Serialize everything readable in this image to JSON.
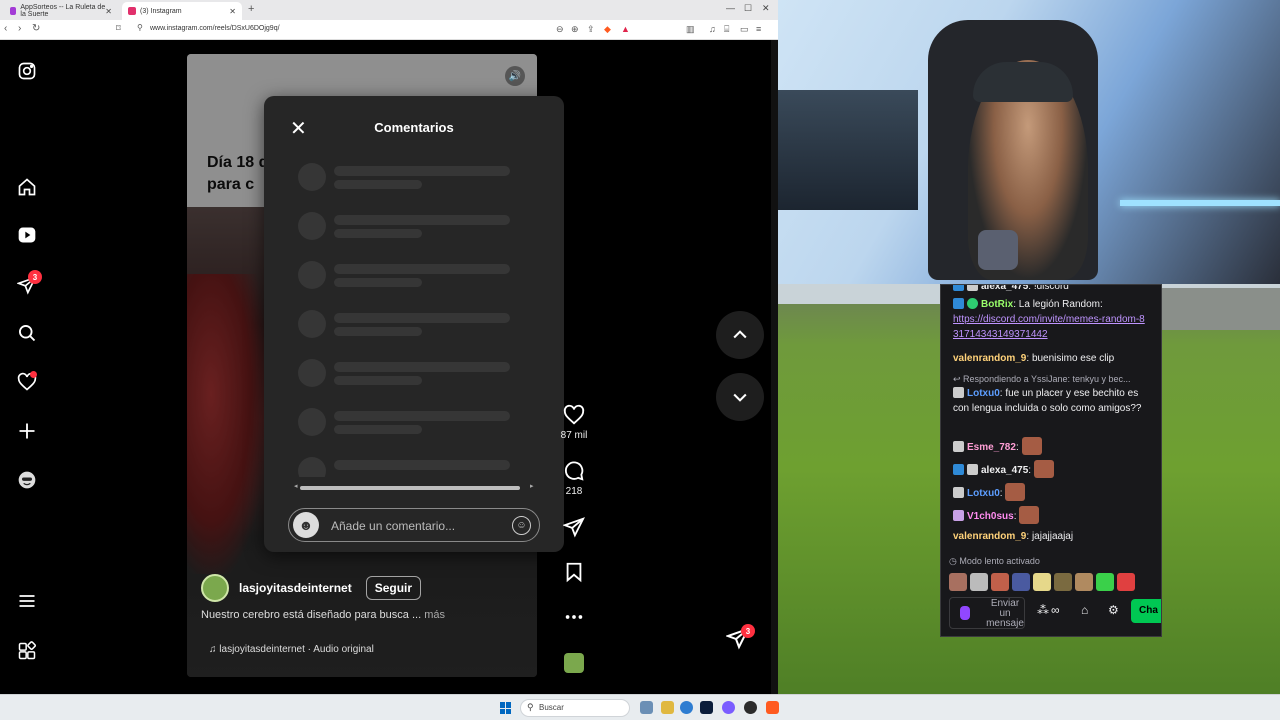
{
  "browser": {
    "tabs": [
      {
        "title": "AppSorteos -- La Ruleta de la Suerte",
        "favicon_color": "#a33bd6"
      },
      {
        "title": "(3) Instagram",
        "favicon_color": "#e1306c"
      }
    ],
    "url": "www.instagram.com/reels/DSxU6DOjg9q/"
  },
  "instagram": {
    "sidebar": {
      "items": [
        "instagram-logo",
        "home",
        "reels",
        "messages",
        "search",
        "notifications",
        "create",
        "profile",
        "more",
        "also-from-meta"
      ],
      "messages_badge": "3"
    },
    "reel": {
      "caption": "Día 18 de\npara c",
      "author": "lasjoyitasdeinternet",
      "follow_label": "Seguir",
      "description": "Nuestro cerebro está diseñado para busca ...",
      "more_label": "más",
      "audio": "lasjoyitasdeinternet · Audio original"
    },
    "actions": {
      "likes": "87 mil",
      "comments": "218"
    },
    "comments_panel": {
      "title": "Comentarios",
      "placeholder": "Añade un comentario..."
    },
    "floating_badge": "3"
  },
  "chat": {
    "messages": [
      {
        "user": "alexa_475",
        "text": "!discord",
        "color": "#efeff1"
      },
      {
        "user": "BotRix",
        "text": "La legión Random:",
        "link": "https://discord.com/invite/memes-random-831714343149371442",
        "color": "#9aff6b"
      },
      {
        "user": "valenrandom_9",
        "text": "buenisimo ese clip",
        "color": "#ffd27a"
      },
      {
        "reply_to": "Respondiendo a YssiJane: tenkyu y bec..."
      },
      {
        "user": "Lotxu0",
        "text": "fue un placer y ese bechito es con lengua incluida o solo como amigos??",
        "color": "#5c9dff"
      },
      {
        "user": "Esme_782",
        "text": "",
        "color": "#ff9ed5"
      },
      {
        "user": "alexa_475",
        "text": "",
        "color": "#efeff1"
      },
      {
        "user": "Lotxu0",
        "text": "",
        "color": "#5c9dff"
      },
      {
        "user": "V1ch0sus",
        "text": "",
        "color": "#ff8cf0"
      },
      {
        "user": "valenrandom_9",
        "text": "jajajjaajaj",
        "color": "#ffd27a"
      }
    ],
    "slow_mode": "Modo lento activado",
    "input_placeholder": "Enviar un mensaje",
    "send_label": "Cha"
  },
  "taskbar": {
    "search_label": "Buscar"
  }
}
